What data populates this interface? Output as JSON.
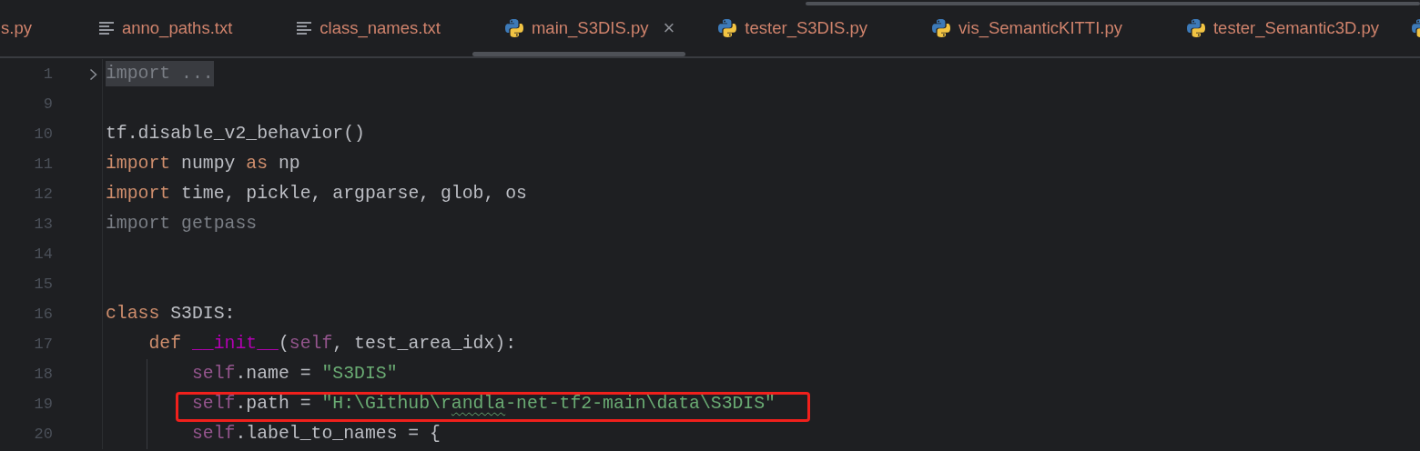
{
  "tabs": [
    {
      "label": "s.py",
      "kind": "cut",
      "selected": false
    },
    {
      "label": "anno_paths.txt",
      "kind": "text",
      "selected": false
    },
    {
      "label": "class_names.txt",
      "kind": "text",
      "selected": false
    },
    {
      "label": "main_S3DIS.py",
      "kind": "python",
      "selected": true,
      "close": "×"
    },
    {
      "label": "tester_S3DIS.py",
      "kind": "python",
      "selected": false
    },
    {
      "label": "vis_SemanticKITTI.py",
      "kind": "python",
      "selected": false
    },
    {
      "label": "tester_Semantic3D.py",
      "kind": "python",
      "selected": false
    },
    {
      "kind": "python",
      "selected": false
    }
  ],
  "lines": [
    {
      "number": "1",
      "folded": true,
      "tokens": [
        {
          "kind": "dim",
          "text": "import ..."
        }
      ]
    },
    {
      "number": "9"
    },
    {
      "number": "10",
      "tokens": [
        {
          "kind": "plain",
          "text": "tf.disable_v2_behavior()"
        }
      ]
    },
    {
      "number": "11",
      "tokens": [
        {
          "kind": "kw",
          "text": "import"
        },
        {
          "kind": "plain",
          "text": " numpy "
        },
        {
          "kind": "kw",
          "text": "as"
        },
        {
          "kind": "plain",
          "text": " np"
        }
      ]
    },
    {
      "number": "12",
      "tokens": [
        {
          "kind": "kw",
          "text": "import"
        },
        {
          "kind": "plain",
          "text": " time, pickle, argparse, glob, os"
        }
      ]
    },
    {
      "number": "13",
      "tokens": [
        {
          "kind": "dim",
          "text": "import getpass"
        }
      ]
    },
    {
      "number": "14"
    },
    {
      "number": "15"
    },
    {
      "number": "16",
      "tokens": [
        {
          "kind": "kw",
          "text": "class"
        },
        {
          "kind": "plain",
          "text": " S3DIS:"
        }
      ],
      "children": [
        {
          "number": "17",
          "tokens": [
            {
              "kind": "kw",
              "text": "def "
            },
            {
              "kind": "dunder",
              "text": "__init__"
            },
            {
              "kind": "plain",
              "text": "("
            },
            {
              "kind": "self",
              "text": "self"
            },
            {
              "kind": "plain",
              "text": ", test_area_idx):"
            }
          ],
          "children": [
            {
              "number": "18",
              "tokens": [
                {
                  "kind": "self",
                  "text": "self"
                },
                {
                  "kind": "plain",
                  "text": ".name = "
                },
                {
                  "kind": "str",
                  "text": "\"S3DIS\""
                }
              ]
            },
            {
              "number": "19",
              "boxed": true,
              "tokens": [
                {
                  "kind": "self",
                  "text": "self"
                },
                {
                  "kind": "plain",
                  "text": ".path = "
                },
                {
                  "kind": "str",
                  "text": "\"H:\\Github\\r"
                },
                {
                  "kind": "str",
                  "text": "andla",
                  "typo": true
                },
                {
                  "kind": "str",
                  "text": "-net-tf2-main\\data\\S3DIS\""
                }
              ]
            },
            {
              "number": "20",
              "tokens": [
                {
                  "kind": "self",
                  "text": "self"
                },
                {
                  "kind": "plain",
                  "text": ".label_to_names = {"
                }
              ]
            }
          ]
        }
      ]
    }
  ]
}
